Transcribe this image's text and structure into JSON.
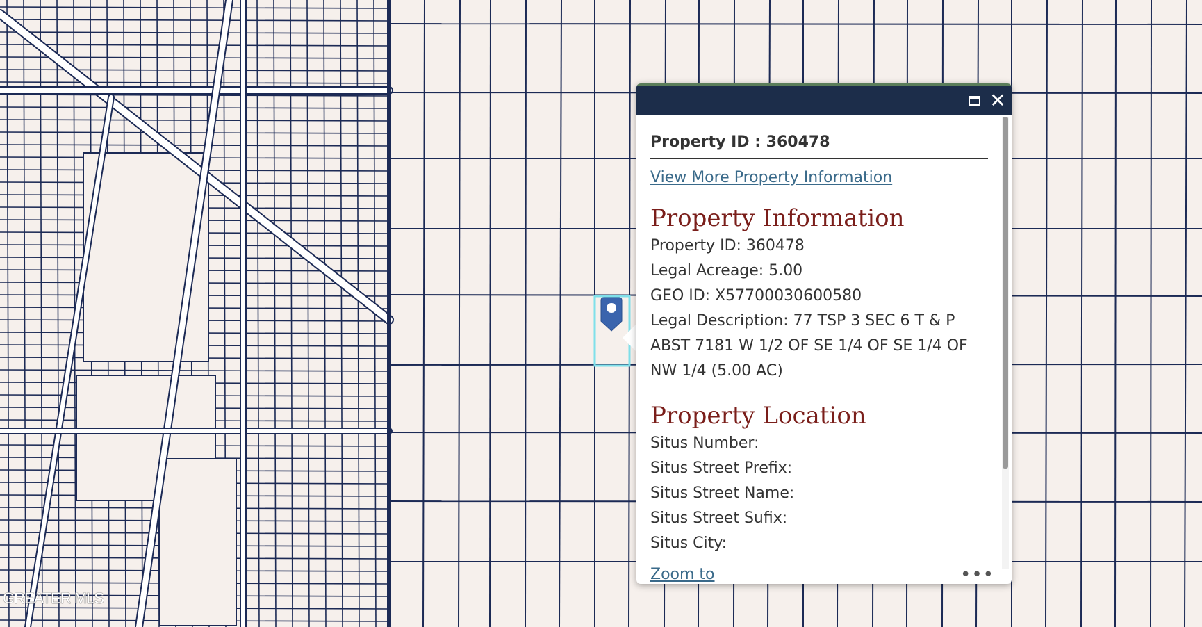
{
  "map": {
    "background_color": "#f6f0ec",
    "parcel_line_color": "#1c2a55",
    "street_color": "#ffffff",
    "highlight_color": "#7fe0ea",
    "marker_color": "#3a64ad",
    "marker_icon": "map-pin-icon"
  },
  "watermark": "GREATER MLS",
  "popup": {
    "header": {
      "maximize_icon": "maximize-icon",
      "close_icon": "close-icon",
      "color": "#1c2d4a"
    },
    "title": "Property ID : 360478",
    "more_info_link": "View More Property Information",
    "sections": [
      {
        "heading": "Property Information",
        "rows": [
          "Property ID: 360478",
          "Legal Acreage: 5.00",
          "GEO ID: X57700030600580",
          "Legal Description: 77 TSP 3 SEC 6 T & P ABST 7181 W 1/2 OF SE 1/4 OF SE 1/4 OF NW 1/4 (5.00 AC)"
        ]
      },
      {
        "heading": "Property Location",
        "rows": [
          "Situs Number:",
          "Situs Street Prefix:",
          "Situs Street Name:",
          "Situs Street Sufix:",
          "Situs City:"
        ]
      }
    ],
    "heading_color": "#7a1e1a",
    "link_color": "#3a6a8a",
    "footer": {
      "zoom_link": "Zoom to",
      "more_icon": "more-options-icon",
      "more_glyph": "•••"
    }
  }
}
